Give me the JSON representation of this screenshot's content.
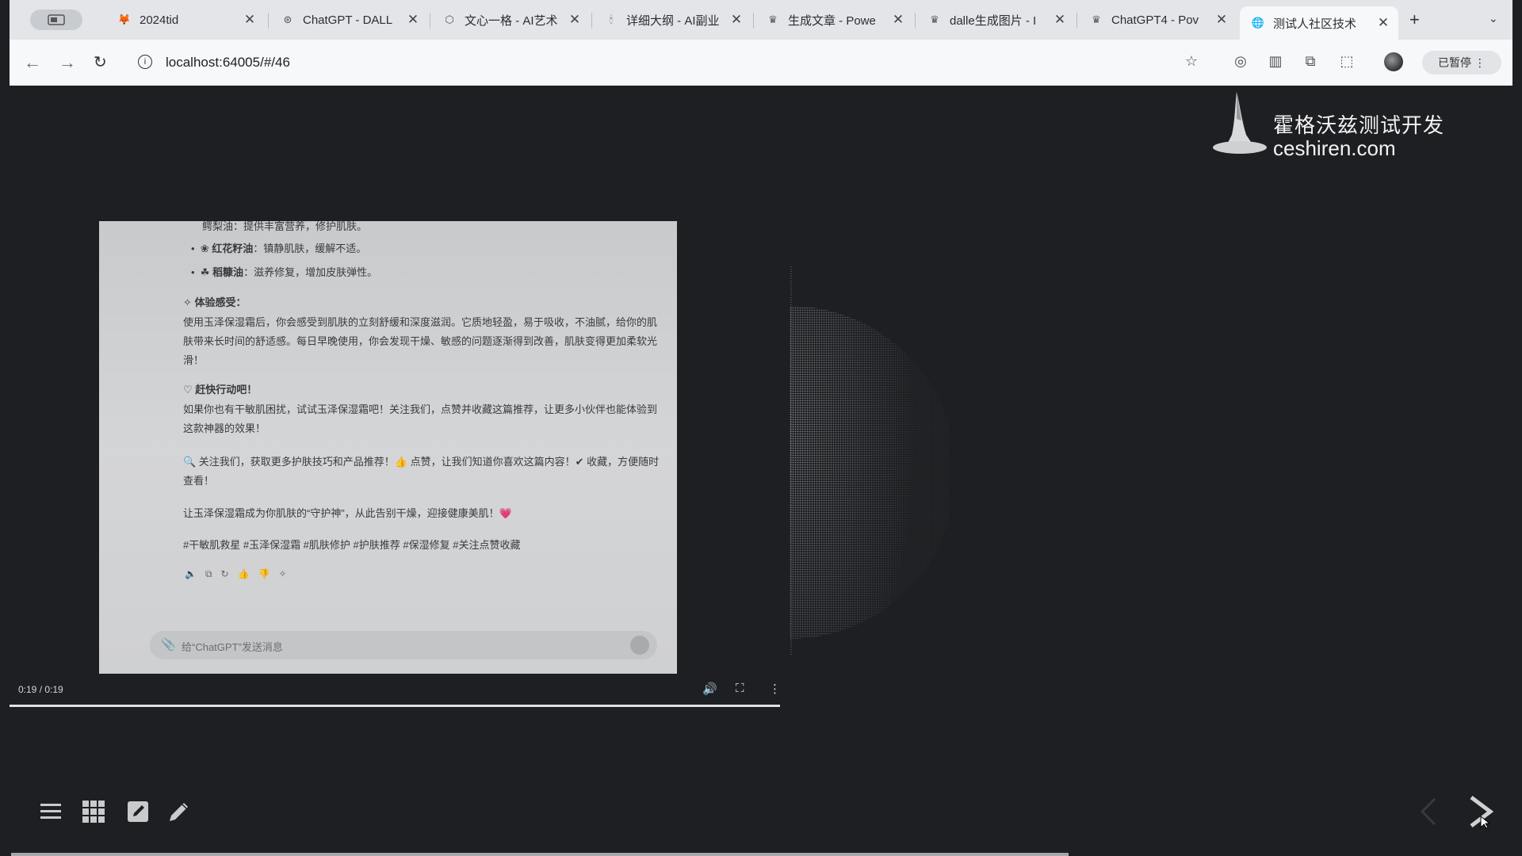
{
  "browser": {
    "tabs": [
      {
        "title": "2024tid",
        "favicon": "gitlab-fox-icon"
      },
      {
        "title": "ChatGPT - DALL",
        "favicon": "openai-icon"
      },
      {
        "title": "文心一格 - AI艺术",
        "favicon": "wenxin-icon"
      },
      {
        "title": "详细大纲 - AI副业",
        "favicon": "candle-icon"
      },
      {
        "title": "生成文章 - Powe",
        "favicon": "crown-icon"
      },
      {
        "title": "dalle生成图片 - I",
        "favicon": "crown-icon"
      },
      {
        "title": "ChatGPT4 - Pov",
        "favicon": "crown-icon"
      },
      {
        "title": "测试人社区技术",
        "favicon": "globe-icon",
        "active": true
      }
    ],
    "url": "localhost:64005/#/46",
    "profile_label": "已暂停"
  },
  "logo": {
    "name_cn": "霍格沃兹测试开发",
    "domain": "ceshiren.com"
  },
  "video": {
    "time": "0:19 / 0:19",
    "progress_fraction": 1.0,
    "content": {
      "bullet_1": "鳄梨油：提供丰富营养，修护肌肤。",
      "bullet_2_label": "红花籽油",
      "bullet_2_text": "：镇静肌肤，缓解不适。",
      "bullet_3_label": "稻糠油",
      "bullet_3_text": "：滋养修复，增加皮肤弹性。",
      "experience_heading": "体验感受：",
      "experience_text": "使用玉泽保湿霜后，你会感受到肌肤的立刻舒缓和深度滋润。它质地轻盈，易于吸收，不油腻，给你的肌肤带来长时间的舒适感。每日早晚使用，你会发现干燥、敏感的问题逐渐得到改善，肌肤变得更加柔软光滑！",
      "action_heading": "赶快行动吧！",
      "action_text": "如果你也有干敏肌困扰，试试玉泽保湿霜吧！关注我们，点赞并收藏这篇推荐，让更多小伙伴也能体验到这款神器的效果！",
      "follow_text": "🔍 关注我们，获取更多护肤技巧和产品推荐！👍 点赞，让我们知道你喜欢这篇内容！✔ 收藏，方便随时查看！",
      "closing_text": "让玉泽保湿霜成为你肌肤的“守护神”，从此告别干燥，迎接健康美肌！💗",
      "hashtags": "#干敏肌救星 #玉泽保湿霜 #肌肤修护 #护肤推荐 #保湿修复 #关注点赞收藏",
      "input_placeholder": "给“ChatGPT”发送消息"
    }
  },
  "slide_progress_fraction": 0.7
}
